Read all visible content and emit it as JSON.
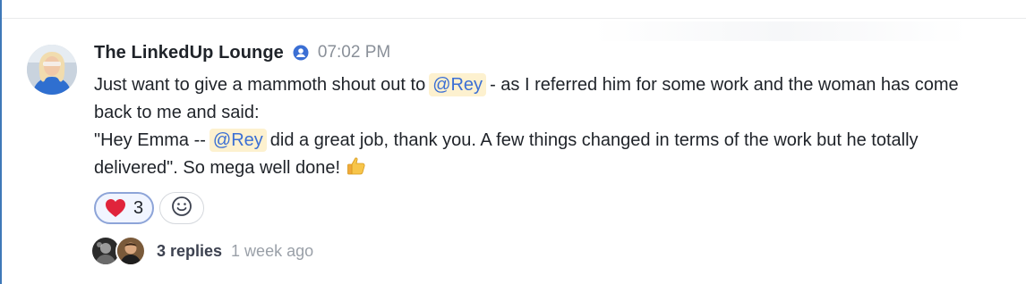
{
  "message": {
    "author": "The LinkedUp Lounge",
    "time": "07:02 PM",
    "lines": {
      "l1_pre": "Just want to give a mammoth shout out to",
      "l1_mention": "@Rey",
      "l1_post": "- as I referred him for some work and the woman has come back to me and said:",
      "l2_pre": "\"Hey Emma --",
      "l2_mention": "@Rey",
      "l2_post": "did a great job, thank you. A few things changed in terms of the work but he totally delivered\". So mega well done!"
    },
    "end_emoji": "thumbs-up-icon"
  },
  "reactions": [
    {
      "icon": "heart-icon",
      "count": "3"
    }
  ],
  "add_reaction_icon": "smiley-add-icon",
  "thread": {
    "replies": "3 replies",
    "when": "1 week ago"
  },
  "colors": {
    "mention_text": "#3b6fd4",
    "mention_bg": "#fdf1cf",
    "reaction_border": "#8da4d8",
    "accent_left_border": "#3e78b8"
  }
}
